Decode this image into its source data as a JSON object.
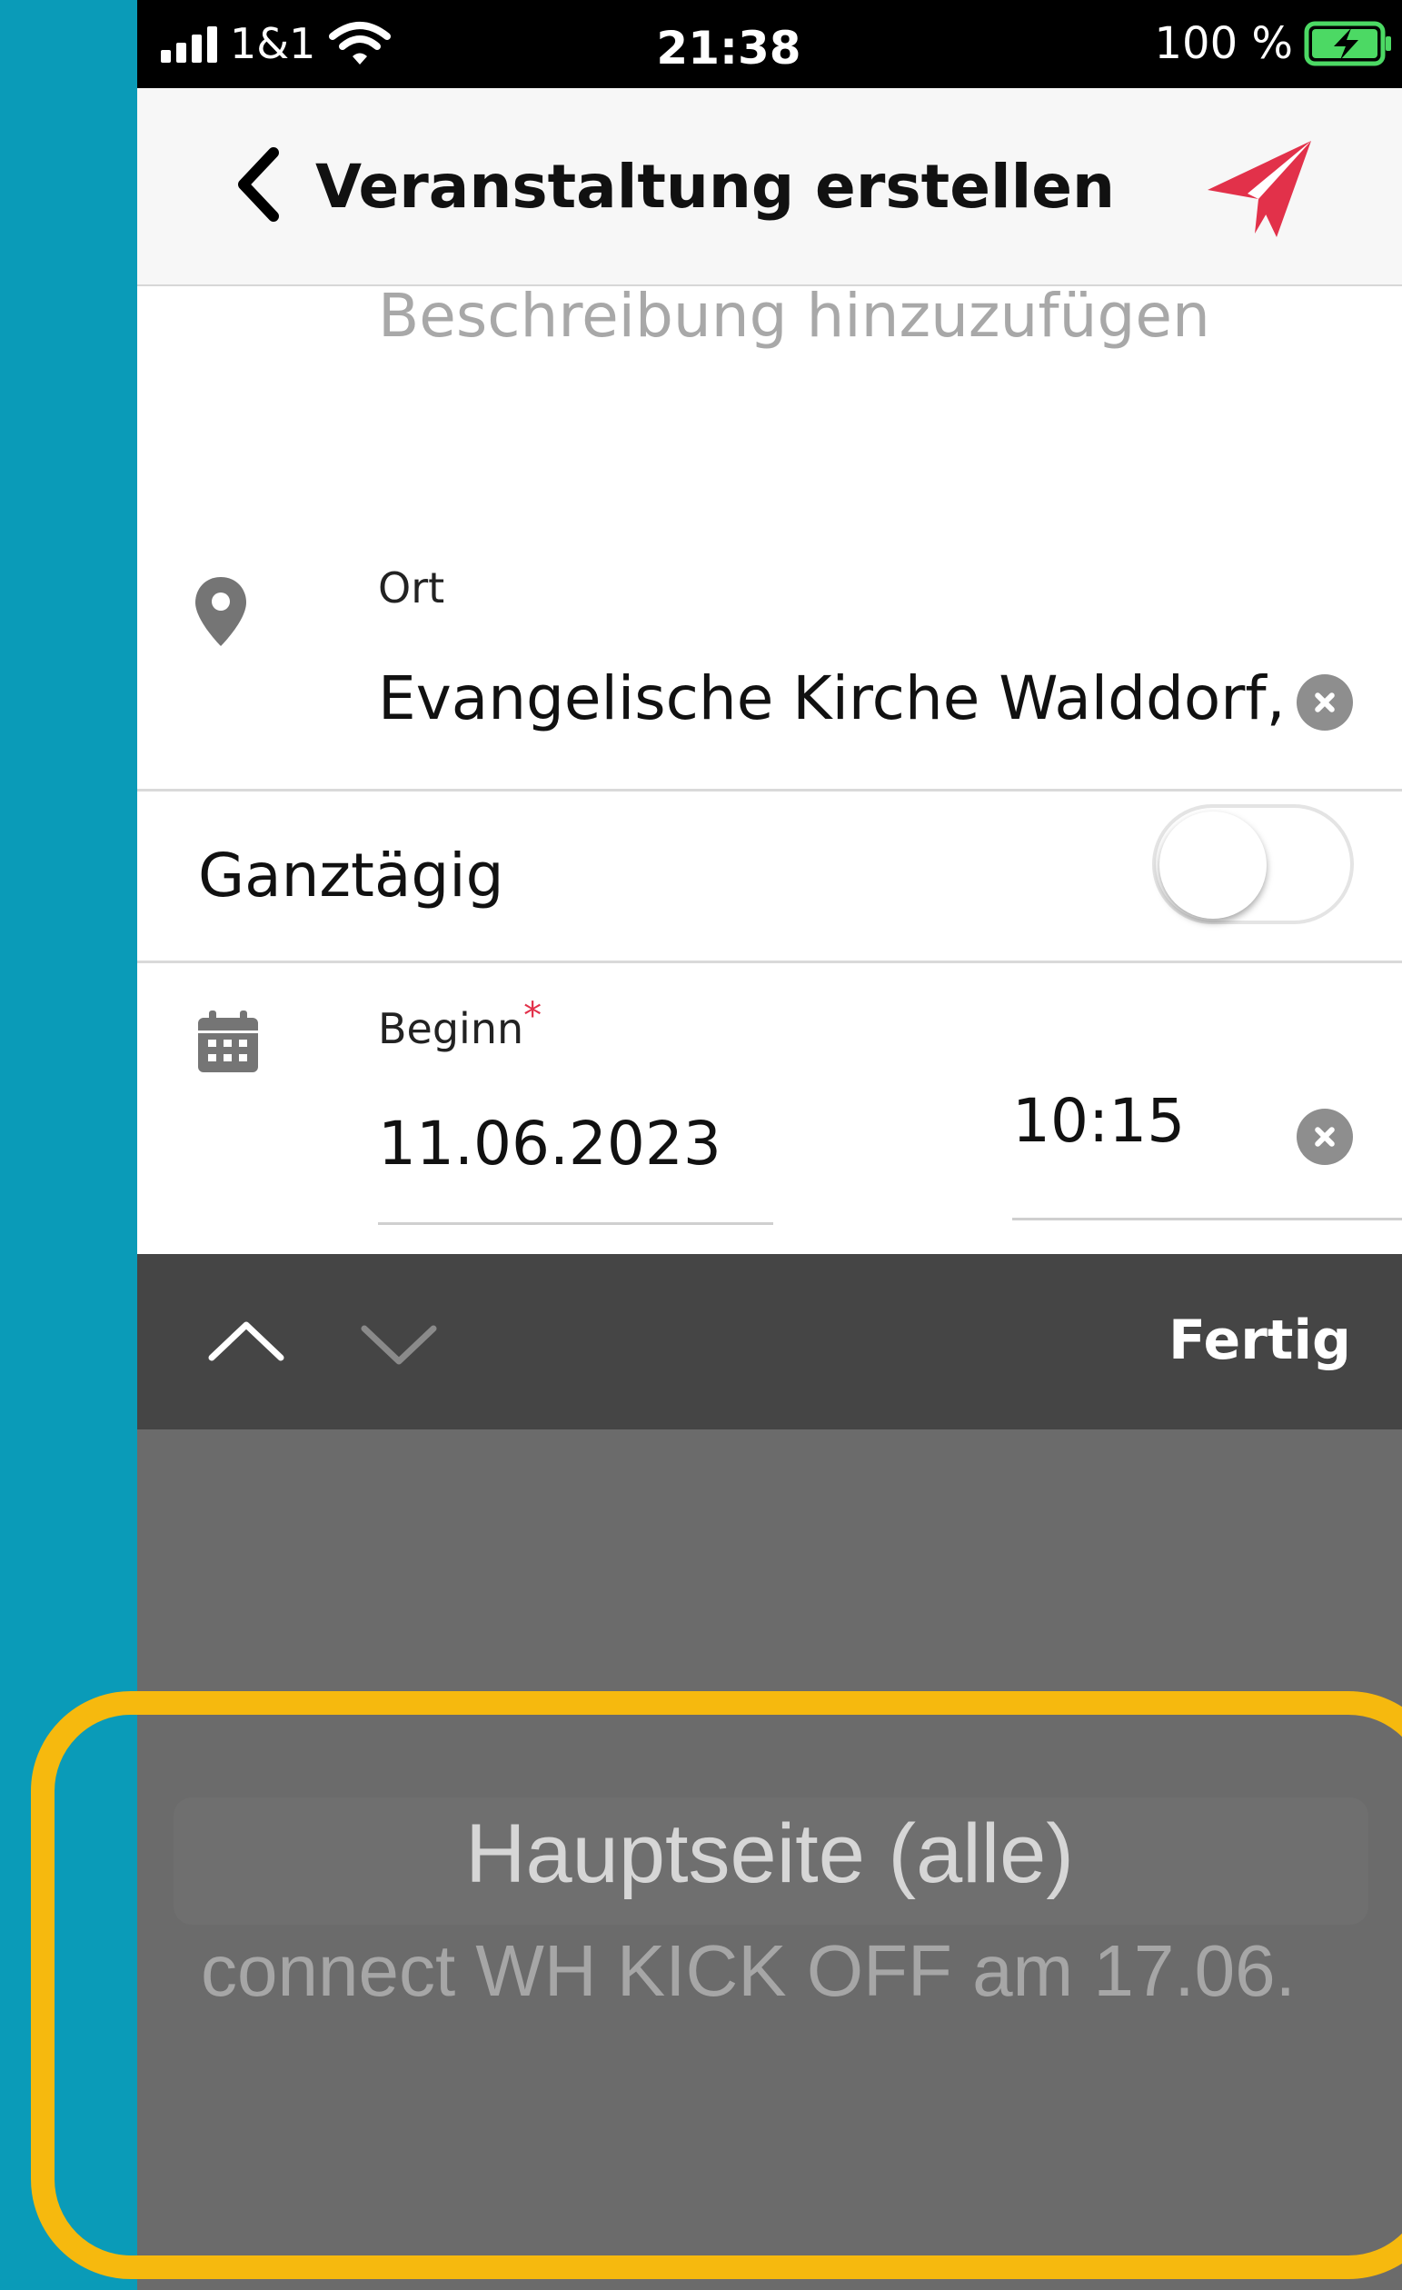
{
  "status_bar": {
    "carrier": "1&1",
    "time": "21:38",
    "battery_percent": "100 %",
    "signal_icon": "signal-bars-icon",
    "wifi_icon": "wifi-icon",
    "battery_icon": "battery-charging-icon"
  },
  "header": {
    "title": "Veranstaltung erstellen",
    "back_icon": "chevron-left-icon",
    "send_icon": "paper-plane-icon",
    "send_color": "#e2314a"
  },
  "form": {
    "description_placeholder": "Beschreibung hinzuzufügen",
    "location": {
      "label": "Ort",
      "value": "Evangelische Kirche Walddorf,",
      "icon": "map-pin-icon"
    },
    "all_day": {
      "label": "Ganztägig",
      "enabled": false
    },
    "start": {
      "label": "Beginn",
      "required_marker": "*",
      "date": "11.06.2023",
      "time": "10:15",
      "icon": "calendar-icon"
    }
  },
  "keyboard_toolbar": {
    "done_label": "Fertig",
    "prev_icon": "chevron-up-icon",
    "next_icon": "chevron-down-icon"
  },
  "picker": {
    "selected": "Hauptseite (alle)",
    "next_option": "connect WH KICK OFF am 17.06."
  },
  "colors": {
    "background": "#0a9bb8",
    "highlight_frame": "#f6b90e",
    "accent": "#e2314a"
  }
}
